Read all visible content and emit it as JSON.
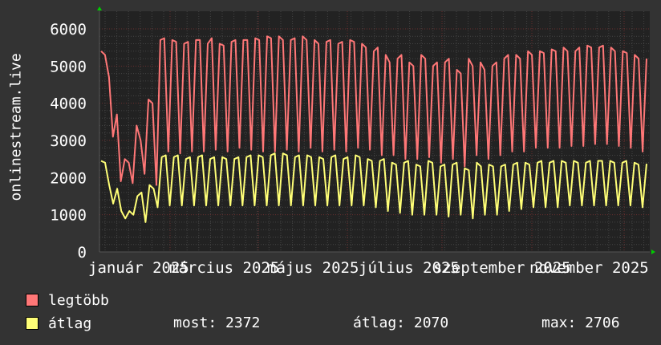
{
  "chart_data": {
    "type": "line",
    "ylabel": "onlinestream.live",
    "ylim": [
      0,
      6000
    ],
    "y_ticks": [
      "0",
      "1000",
      "2000",
      "3000",
      "4000",
      "5000",
      "6000"
    ],
    "x_tick_labels": [
      "január 2025",
      "március 2025",
      "május 2025",
      "július 2025",
      "szeptember 2025",
      "november 2025"
    ],
    "grid": true,
    "legend": "bottom-left",
    "background": "#222222",
    "series": [
      {
        "name": "legtöbb",
        "color": "#ff7777",
        "values": [
          5400,
          5300,
          4700,
          3100,
          3700,
          1900,
          2500,
          2400,
          1850,
          3400,
          3000,
          2100,
          4100,
          4000,
          1800,
          5700,
          5750,
          2700,
          5700,
          5650,
          2650,
          5600,
          5650,
          2700,
          5700,
          5700,
          2700,
          5600,
          5750,
          2750,
          5600,
          5550,
          2700,
          5650,
          5700,
          2800,
          5700,
          5700,
          2750,
          5750,
          5700,
          2700,
          5800,
          5750,
          2700,
          5800,
          5700,
          2750,
          5700,
          5750,
          2700,
          5800,
          5700,
          2800,
          5700,
          5600,
          2700,
          5650,
          5700,
          2750,
          5600,
          5650,
          2700,
          5700,
          5650,
          2800,
          5600,
          5500,
          2750,
          5400,
          5500,
          2600,
          5300,
          5100,
          2600,
          5200,
          5300,
          2500,
          5100,
          5000,
          2500,
          5300,
          5200,
          2550,
          5000,
          5100,
          2400,
          5100,
          5200,
          2500,
          4900,
          4800,
          2300,
          5200,
          5000,
          2600,
          5100,
          4900,
          2500,
          5000,
          5100,
          2600,
          5200,
          5300,
          2700,
          5300,
          5200,
          2700,
          5400,
          5300,
          2800,
          5400,
          5350,
          2800,
          5450,
          5400,
          2800,
          5500,
          5400,
          2850,
          5400,
          5500,
          2850,
          5550,
          5500,
          2900,
          5500,
          5550,
          2900,
          5500,
          5400,
          2850,
          5400,
          5350,
          2800,
          5300,
          5200,
          2700,
          5200
        ]
      },
      {
        "name": "átlag",
        "color": "#ffff77",
        "values": [
          2450,
          2400,
          1800,
          1300,
          1700,
          1100,
          900,
          1100,
          1000,
          1500,
          1600,
          800,
          1800,
          1700,
          1200,
          2550,
          2600,
          1250,
          2550,
          2600,
          1250,
          2500,
          2550,
          1250,
          2550,
          2600,
          1250,
          2500,
          2550,
          1250,
          2550,
          2500,
          1250,
          2500,
          2550,
          1250,
          2550,
          2600,
          1250,
          2600,
          2550,
          1250,
          2600,
          2650,
          1250,
          2650,
          2600,
          1250,
          2550,
          2600,
          1250,
          2600,
          2550,
          1250,
          2550,
          2500,
          1250,
          2550,
          2600,
          1250,
          2500,
          2550,
          1250,
          2600,
          2550,
          1250,
          2500,
          2450,
          1200,
          2450,
          2500,
          1100,
          2400,
          2350,
          1050,
          2400,
          2450,
          1000,
          2350,
          2300,
          1000,
          2450,
          2400,
          1000,
          2300,
          2350,
          950,
          2350,
          2400,
          1000,
          2250,
          2200,
          900,
          2400,
          2300,
          1000,
          2350,
          2300,
          1000,
          2300,
          2350,
          1100,
          2350,
          2400,
          1150,
          2400,
          2350,
          1200,
          2400,
          2450,
          1200,
          2400,
          2450,
          1200,
          2450,
          2400,
          1250,
          2450,
          2400,
          1250,
          2400,
          2450,
          1250,
          2450,
          2450,
          1250,
          2450,
          2400,
          1250,
          2400,
          2450,
          1250,
          2400,
          2350,
          1200,
          2372
        ]
      }
    ]
  },
  "legend": {
    "items": [
      {
        "label": "legtöbb"
      },
      {
        "label": "átlag"
      }
    ],
    "stats": {
      "most": "most: 2372",
      "atlag": "átlag: 2070",
      "max": "max: 2706"
    }
  }
}
